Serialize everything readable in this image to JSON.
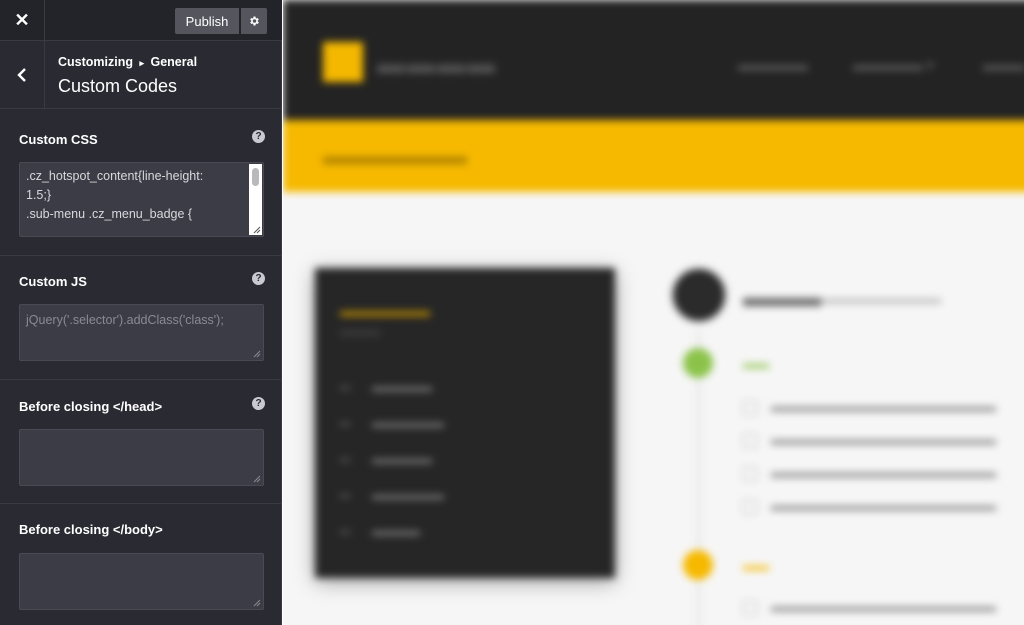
{
  "toolbar": {
    "close_icon": "close-icon",
    "publish_label": "Publish",
    "settings_icon": "gear-icon"
  },
  "header": {
    "breadcrumb_parent": "Customizing",
    "breadcrumb_separator": "▸",
    "breadcrumb_current": "General",
    "title": "Custom Codes"
  },
  "controls": [
    {
      "label": "Custom CSS",
      "has_help": true,
      "value_lines": [
        ".cz_hotspot_content{line-height:",
        "1.5;}",
        ".sub-menu .cz_menu_badge {"
      ]
    },
    {
      "label": "Custom JS",
      "has_help": true,
      "placeholder": "jQuery('.selector').addClass('class');"
    },
    {
      "label": "Before closing </head>",
      "has_help": true,
      "value": ""
    },
    {
      "label": "Before closing </body>",
      "has_help": false,
      "value": ""
    }
  ],
  "colors": {
    "sidebar_bg": "#2a2a33",
    "accent": "#f6b900",
    "field_bg": "#3c3c46"
  }
}
